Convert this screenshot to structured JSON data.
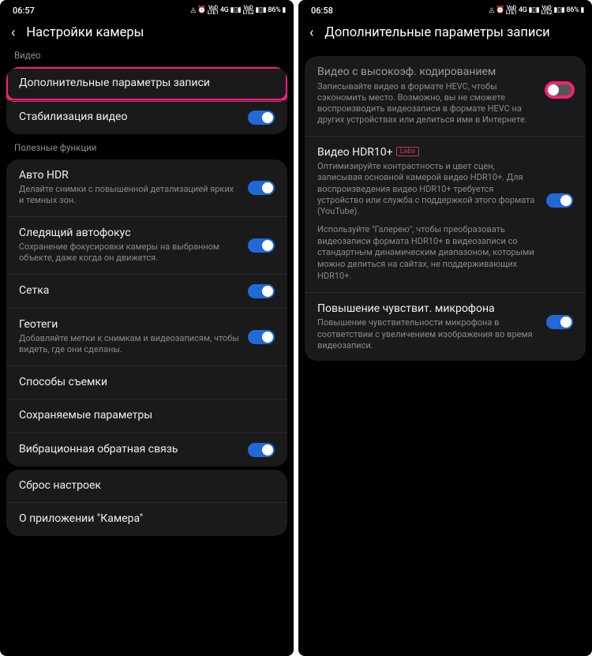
{
  "left": {
    "status": {
      "time": "06:57",
      "icons": "⏰ VoLTE1 4G ␋ VoLTE2 ␋ 86% ▮"
    },
    "header": {
      "title": "Настройки камеры"
    },
    "section_video_label": "Видео",
    "items": {
      "advanced_recording": "Дополнительные параметры записи",
      "stabilization": "Стабилизация видео"
    },
    "section_useful_label": "Полезные функции",
    "useful": {
      "auto_hdr_title": "Авто HDR",
      "auto_hdr_sub": "Делайте снимки с повышенной детализацией ярких и темных зон.",
      "tracking_af_title": "Следящий автофокус",
      "tracking_af_sub": "Сохранение фокусировки камеры на выбранном объекте, даже когда он движется.",
      "grid_title": "Сетка",
      "geotags_title": "Геотеги",
      "geotags_sub": "Добавляйте метки к снимкам и видеозаписям, чтобы видеть, где они сделаны.",
      "shooting_methods": "Способы съемки",
      "saved_settings": "Сохраняемые параметры",
      "vibration_feedback": "Вибрационная обратная связь"
    },
    "footer": {
      "reset": "Сброс настроек",
      "about": "О приложении \"Камера\""
    }
  },
  "right": {
    "status": {
      "time": "06:58",
      "icons": "⏰ VoLTE1 4G ␋ VoLTE2 ␋ 86% ▮"
    },
    "header": {
      "title": "Дополнительные параметры записи"
    },
    "items": {
      "hevc_title": "Видео с высокоэф. кодированием",
      "hevc_sub": "Записывайте видео в формате HEVC, чтобы сэкономить место. Возможно, вы не сможете воспроизводить видеозаписи в формате HEVC на других устройствах или делиться ими в Интернете.",
      "hdr10_title": "Видео HDR10+",
      "hdr10_badge": "Labs",
      "hdr10_sub1": "Оптимизируйте контрастность и цвет сцен, записывая основной камерой видео HDR10+. Для воспроизведения видео HDR10+ требуется устройство или служба с поддержкой этого формата (YouTube).",
      "hdr10_sub2": "Используйте \"Галерею\", чтобы преобразовать видеозаписи формата HDR10+ в видеозаписи со стандартным динамическим диапазоном, которыми можно делиться на сайтах, не поддерживающих HDR10+.",
      "mic_title": "Повышение чувствит. микрофона",
      "mic_sub": "Повышение чувствительности микрофона в соответствии с увеличением изображения во время видеозаписи."
    }
  }
}
